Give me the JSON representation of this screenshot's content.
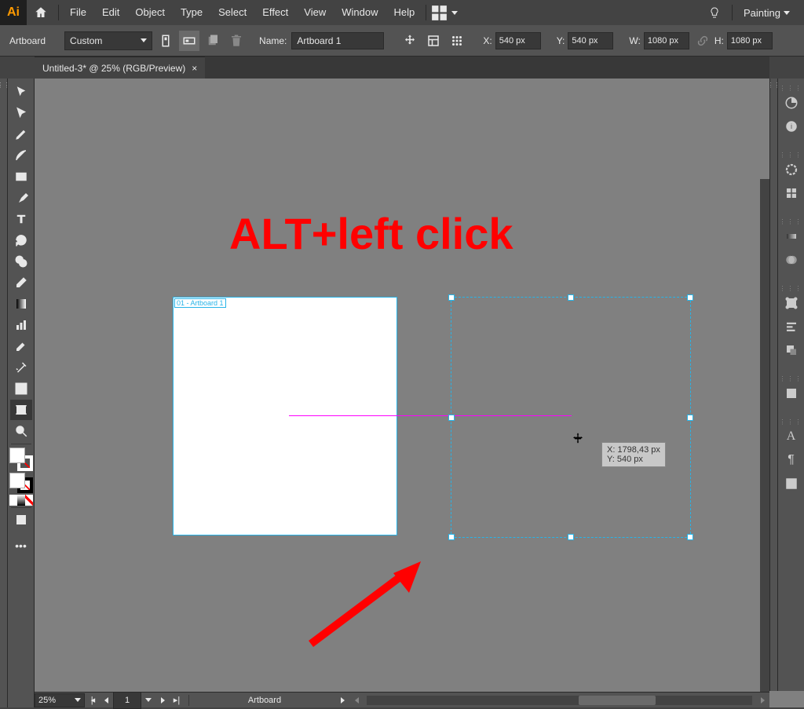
{
  "menubar": {
    "logo": "Ai",
    "items": [
      "File",
      "Edit",
      "Object",
      "Type",
      "Select",
      "Effect",
      "View",
      "Window",
      "Help"
    ],
    "workspace": "Painting"
  },
  "controlbar": {
    "tool_label": "Artboard",
    "preset": "Custom",
    "name_label": "Name:",
    "name_value": "Artboard 1",
    "x_label": "X:",
    "x_value": "540 px",
    "y_label": "Y:",
    "y_value": "540 px",
    "w_label": "W:",
    "w_value": "1080 px",
    "h_label": "H:",
    "h_value": "1080 px"
  },
  "tab": {
    "title": "Untitled-3* @ 25% (RGB/Preview)"
  },
  "canvas": {
    "artboard1_label": "01 - Artboard 1",
    "tooltip_x": "X: 1798,43 px",
    "tooltip_y": "Y: 540 px",
    "annotation": "ALT+left click"
  },
  "statusbar": {
    "zoom": "25%",
    "artboard_num": "1",
    "mode_label": "Artboard"
  }
}
